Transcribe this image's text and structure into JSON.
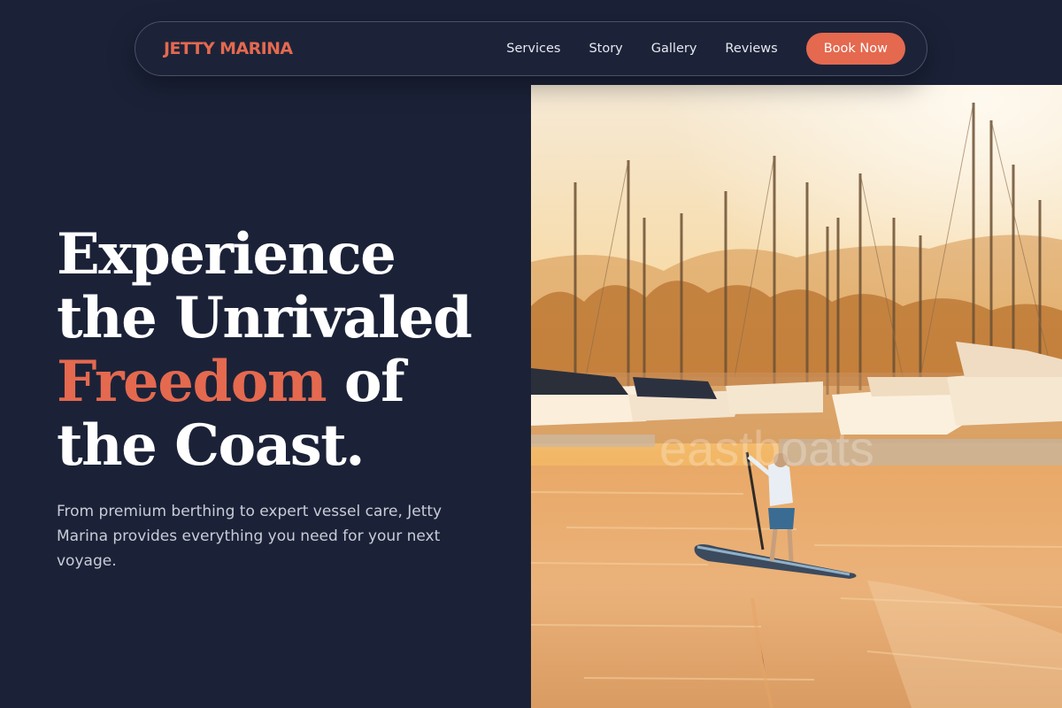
{
  "brand": {
    "name": "JETTY MARINA"
  },
  "nav": {
    "links": [
      "Services",
      "Story",
      "Gallery",
      "Reviews"
    ],
    "cta": "Book Now"
  },
  "hero": {
    "title_line1": "Experience",
    "title_line2": "the Unrivaled",
    "title_accent": "Freedom",
    "title_line3_rest": " of",
    "title_line4": "the Coast.",
    "subtitle": "From premium berthing to expert vessel care, Jetty Marina provides everything you need for your next voyage."
  },
  "image": {
    "watermark": "eastboats"
  },
  "colors": {
    "background": "#1b2238",
    "accent": "#e4694f",
    "text": "#ffffff",
    "muted": "#c9ccd6"
  }
}
